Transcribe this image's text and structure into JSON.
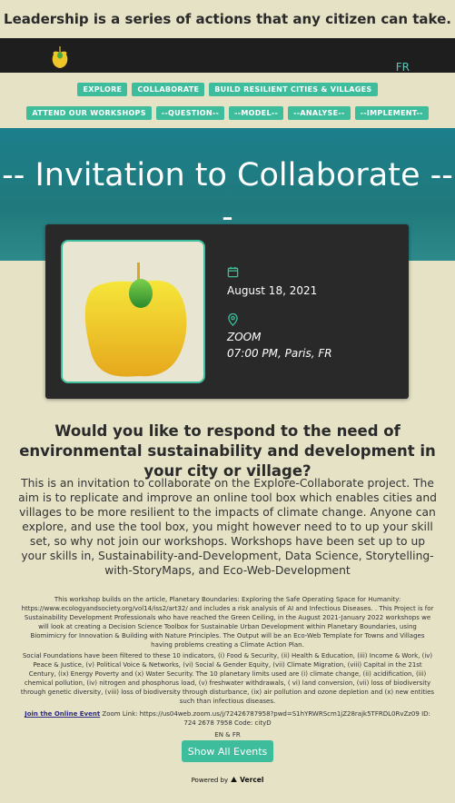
{
  "banner": "Leadership is a series of actions that any citizen can take.",
  "nav": {
    "logo_icon": "apple-logo-icon",
    "lang_toggle": "FR"
  },
  "tags_row1": [
    "EXPLORE",
    "COLLABORATE",
    "BUILD RESILIENT CITIES & VILLAGES"
  ],
  "tags_row2": [
    "ATTEND OUR WORKSHOPS",
    "--QUESTION--",
    "--MODEL--",
    "--ANALYSE--",
    "--IMPLEMENT--"
  ],
  "hero": {
    "title_line1": "-- Invitation to Collaborate --",
    "title_line2": "-"
  },
  "event": {
    "date": "August 18, 2021",
    "location": "ZOOM",
    "time": "07:00 PM, Paris, FR",
    "date_icon": "calendar-icon",
    "location_icon": "map-pin-icon"
  },
  "question": "Would you like to respond to the need of environmental sustainability and development in your city or village?",
  "invite": "This is an invitation to collaborate on the Explore-Collaborate project. The aim is to replicate and improve an online tool box which enables cities and villages to be more resilient to the impacts of climate change. Anyone can explore, and use the tool box, you might however need to to up your skill set, so why not join our workshops. Workshops have been set up to up your skills in, Sustainability-and-Development, Data Science, Storytelling-with-StoryMaps, and Eco-Web-Development",
  "details_p1": "This workshop builds on the article, Planetary Boundaries: Exploring the Safe Operating Space for Humanity: https://www.ecologyandsociety.org/vol14/iss2/art32/ and includes a risk analysis of AI and Infectious Diseases. .  This Project is for Sustainability Development Professionals who have reached the Green Ceiling, in the August 2021-January 2022 workshops we will look at creating a Decision Science Toolbox for Sustainable Urban Development within Planetary Boundaries, using Biomimicry for Innovation & Building with Nature Principles. The Output will be an Eco-Web Template for Towns and Villages having problems creating a Climate Action Plan.",
  "details_p2": "Social Foundations have been filtered to these 10 indicators, (i) Food & Security, (ii) Health & Education, (iii) Income & Work, (iv) Peace & Justice, (v) Political Voice & Networks, (vi) Social & Gender Equity, (vii) Climate Migration, (viii) Capital in the 21st Century, (ix) Energy Poverty and (x) Water Security. The 10 planetary limits used are (i) climate change, (ii) acidification, (iii) chemical pollution, (iv) nitrogen and phosphorus load, (v) freshwater withdrawals, ( vi) land conversion, (vii) loss of biodiversity through genetic diversity, (viii) loss of biodiversity through disturbance, (ix) air pollution and ozone depletion and (x) new entities such than infectious diseases.",
  "join": {
    "link_label": "Join the Online Event",
    "zoom_text": "Zoom Link: https://us04web.zoom.us/j/72426787958?pwd=S1hYRWRScm1jZ28rajk5TFRDL0RvZz09 ID: 724 2678 7958  Code: cityD"
  },
  "languages": "EN & FR",
  "show_all_button": "Show All Events",
  "footer": {
    "powered_by": "Powered by",
    "brand": "Vercel",
    "brand_icon": "vercel-triangle-icon"
  },
  "colors": {
    "accent": "#3dbd9c",
    "background": "#e5e2c6",
    "navbar": "#1e1e1e",
    "card": "#292929",
    "hero": "#1c7f8c"
  }
}
